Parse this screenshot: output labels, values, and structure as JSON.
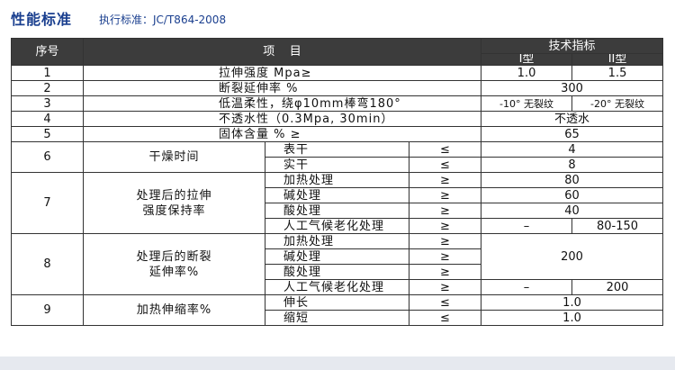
{
  "header": {
    "title": "性能标准",
    "standard": "执行标准：JC/T864-2008"
  },
  "table": {
    "headers": {
      "no": "序号",
      "item": "项    目",
      "tech": "技术指标",
      "type1": "I型",
      "type2": "II型"
    },
    "rows": {
      "r1": {
        "no": "1",
        "item": "拉伸强度 Mpa≥",
        "v1": "1.0",
        "v2": "1.5"
      },
      "r2": {
        "no": "2",
        "item": "断裂延伸率 %",
        "v": "300"
      },
      "r3": {
        "no": "3",
        "item": "低温柔性，绕φ10mm棒弯180°",
        "v1": "-10° 无裂纹",
        "v2": "-20° 无裂纹"
      },
      "r4": {
        "no": "4",
        "item": "不透水性（0.3Mpa, 30min）",
        "v": "不透水"
      },
      "r5": {
        "no": "5",
        "item": "固体含量 % ≥",
        "v": "65"
      },
      "r6": {
        "no": "6",
        "group": "干燥时间",
        "subs": [
          {
            "name": "表干",
            "sym": "≤",
            "v": "4"
          },
          {
            "name": "实干",
            "sym": "≤",
            "v": "8"
          }
        ]
      },
      "r7": {
        "no": "7",
        "group": "处理后的拉伸\n强度保持率",
        "subs": [
          {
            "name": "加热处理",
            "sym": "≥",
            "v": "80"
          },
          {
            "name": "碱处理",
            "sym": "≥",
            "v": "60"
          },
          {
            "name": "酸处理",
            "sym": "≥",
            "v": "40"
          },
          {
            "name": "人工气候老化处理",
            "sym": "≥",
            "v1": "–",
            "v2": "80-150"
          }
        ]
      },
      "r8": {
        "no": "8",
        "group": "处理后的断裂\n延伸率%",
        "subs": [
          {
            "name": "加热处理",
            "sym": "≥"
          },
          {
            "name": "碱处理",
            "sym": "≥"
          },
          {
            "name": "酸处理",
            "sym": "≥"
          },
          {
            "name": "人工气候老化处理",
            "sym": "≥",
            "v1": "–",
            "v2": "200"
          }
        ],
        "v": "200"
      },
      "r9": {
        "no": "9",
        "group": "加热伸缩率%",
        "subs": [
          {
            "name": "伸长",
            "sym": "≤",
            "v": "1.0"
          },
          {
            "name": "缩短",
            "sym": "≤",
            "v": "1.0"
          }
        ]
      }
    }
  }
}
